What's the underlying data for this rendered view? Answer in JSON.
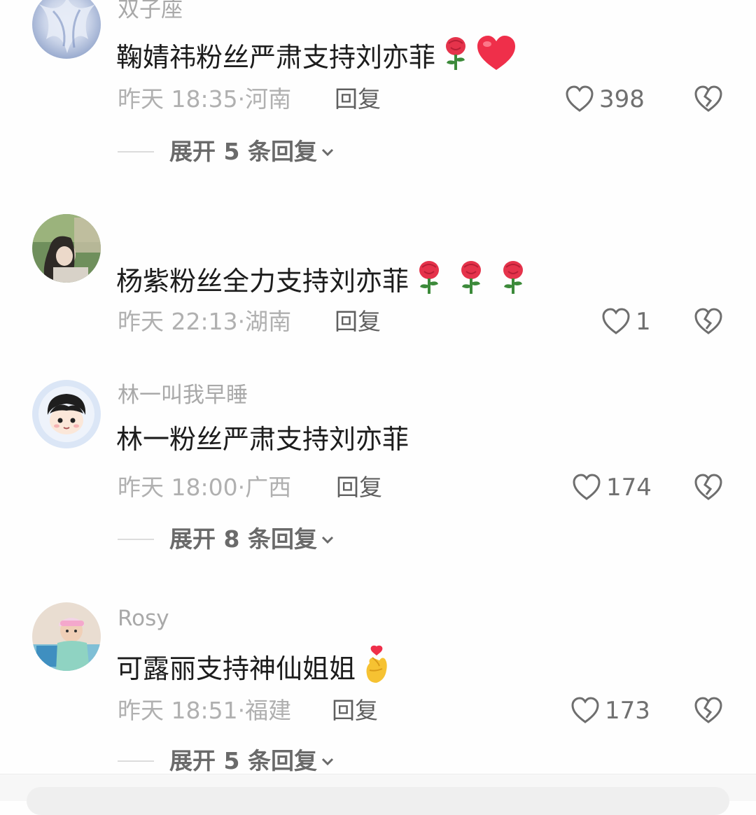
{
  "comments": [
    {
      "username": "双子座",
      "content": "鞠婧祎粉丝严肃支持刘亦菲",
      "time": "昨天 18:35",
      "location": "河南",
      "reply_label": "回复",
      "likes": "398",
      "expand": "展开 5 条回复",
      "emojis": [
        "rose-icon",
        "red-heart-icon"
      ]
    },
    {
      "username": "",
      "content": "杨紫粉丝全力支持刘亦菲",
      "time": "昨天 22:13",
      "location": "湖南",
      "reply_label": "回复",
      "likes": "1",
      "emojis": [
        "rose-icon",
        "rose-icon",
        "rose-icon"
      ]
    },
    {
      "username": "林一叫我早睡",
      "content": "林一粉丝严肃支持刘亦菲",
      "time": "昨天 18:00",
      "location": "广西",
      "reply_label": "回复",
      "likes": "174",
      "expand": "展开 8 条回复"
    },
    {
      "username": "Rosy",
      "content": "可露丽支持神仙姐姐",
      "time": "昨天 18:51",
      "location": "福建",
      "reply_label": "回复",
      "likes": "173",
      "expand": "展开 5 条回复",
      "emojis": [
        "finger-heart-icon"
      ]
    }
  ],
  "icons": {
    "like": "heart-outline-icon",
    "dislike": "broken-heart-icon",
    "expand": "chevron-down-icon"
  },
  "colors": {
    "rose": "#e5334b",
    "heart": "#ef2f4a",
    "finger_heart": "#f6c232"
  }
}
